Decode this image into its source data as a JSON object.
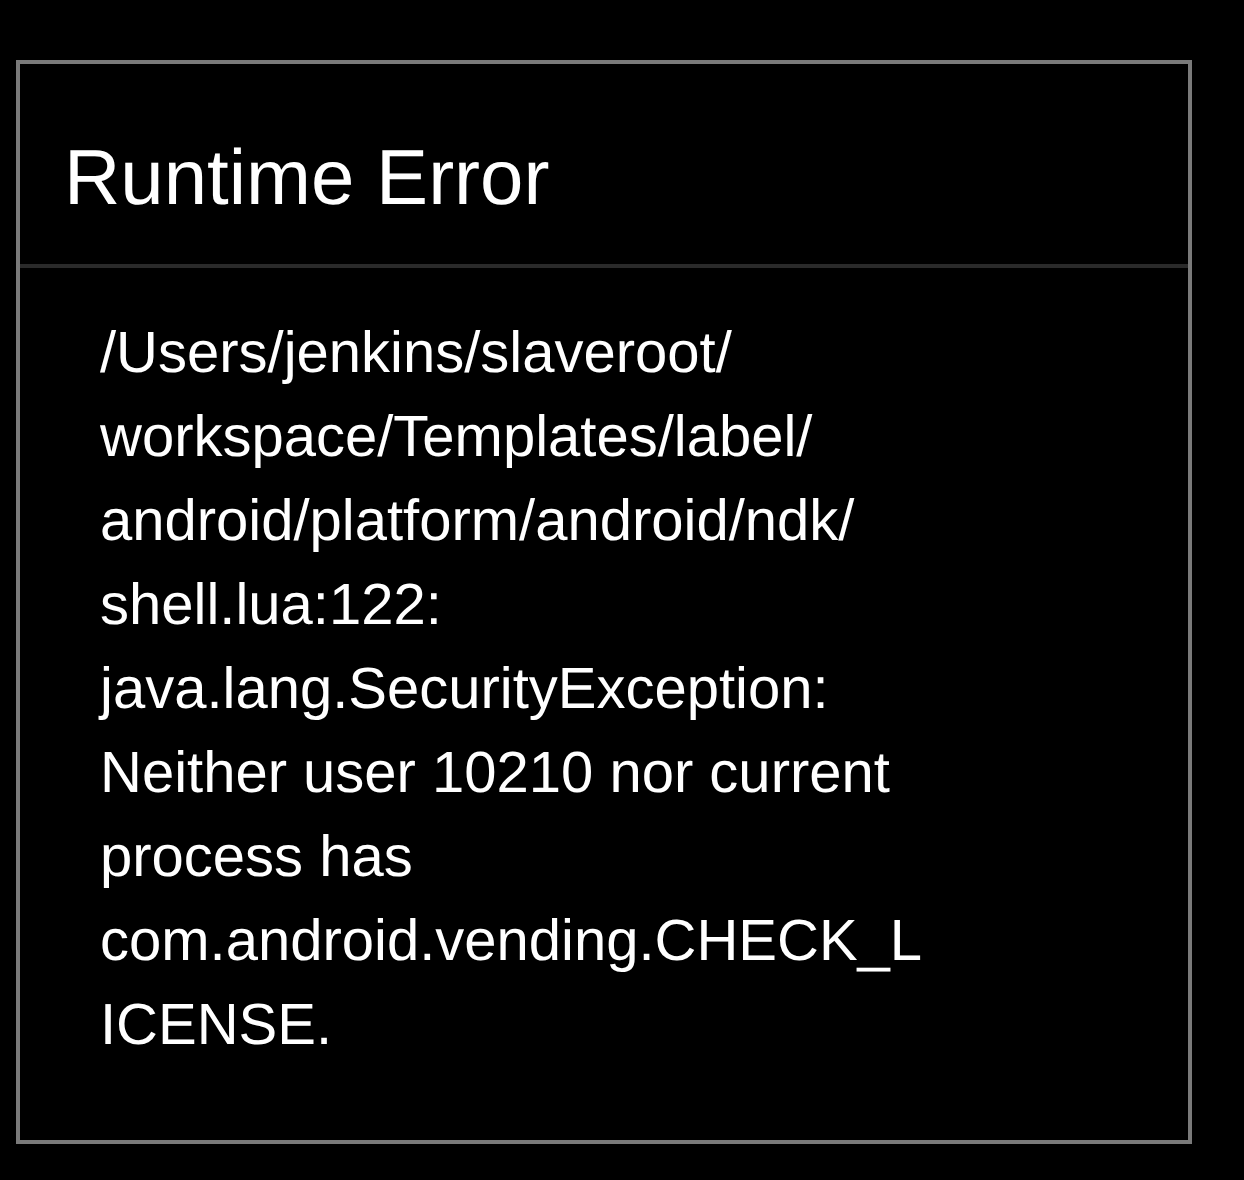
{
  "dialog": {
    "title": "Runtime Error",
    "message_lines": [
      "/Users/jenkins/slaveroot/",
      "workspace/Templates/label/",
      "android/platform/android/ndk/",
      "shell.lua:122:",
      "java.lang.SecurityException:",
      "Neither user 10210 nor current",
      "process has",
      "com.android.vending.CHECK_L",
      "ICENSE."
    ]
  }
}
